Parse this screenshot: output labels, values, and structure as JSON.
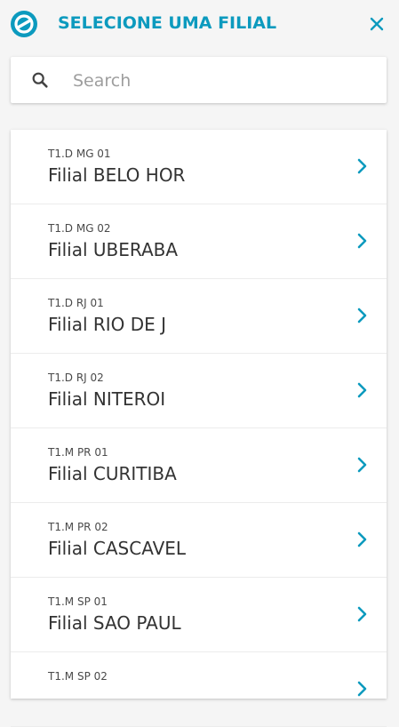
{
  "header": {
    "title": "SELECIONE UMA FILIAL",
    "logo_icon": "totvs-logo-icon",
    "close_icon": "close-icon",
    "accent_color": "#0c9abe"
  },
  "search": {
    "placeholder": "Search",
    "value": "",
    "icon": "search-icon"
  },
  "branches": [
    {
      "code": "T1.D MG 01",
      "name": "Filial BELO HOR"
    },
    {
      "code": "T1.D MG 02",
      "name": "Filial UBERABA"
    },
    {
      "code": "T1.D RJ 01",
      "name": "Filial RIO DE J"
    },
    {
      "code": "T1.D RJ 02",
      "name": "Filial NITEROI"
    },
    {
      "code": "T1.M PR 01",
      "name": "Filial CURITIBA"
    },
    {
      "code": "T1.M PR 02",
      "name": "Filial CASCAVEL"
    },
    {
      "code": "T1.M SP 01",
      "name": "Filial SAO PAUL"
    },
    {
      "code": "T1.M SP 02",
      "name": ""
    }
  ]
}
